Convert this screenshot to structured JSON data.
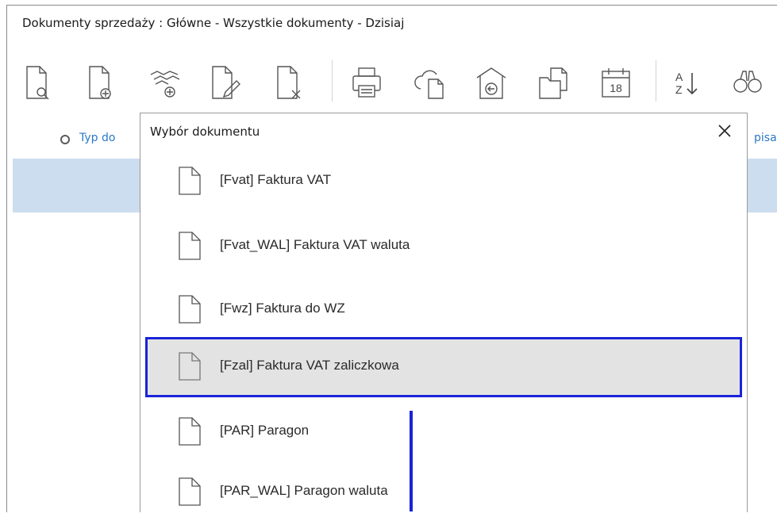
{
  "window": {
    "title": "Dokumenty sprzedaży : Główne - Wszystkie dokumenty - Dzisiaj"
  },
  "toolbar": {
    "icons": [
      "document-preview-icon",
      "document-add-icon",
      "handshake-add-icon",
      "document-edit-icon",
      "document-delete-icon",
      "print-icon",
      "cloud-document-icon",
      "home-export-icon",
      "folder-document-icon",
      "calendar-icon",
      "sort-az-icon",
      "binoculars-icon"
    ],
    "calendar_day": "18",
    "sort_top": "A",
    "sort_bottom": "Z"
  },
  "columns": {
    "typ": "Typ do",
    "opis": "pisa"
  },
  "modal": {
    "title": "Wybór dokumentu",
    "close_icon": "close-icon",
    "items": [
      {
        "label": "[Fvat] Faktura VAT",
        "selected": false
      },
      {
        "label": "[Fvat_WAL] Faktura VAT waluta",
        "selected": false
      },
      {
        "label": "[Fwz] Faktura do WZ",
        "selected": false
      },
      {
        "label": "[Fzal] Faktura VAT zaliczkowa",
        "selected": true
      },
      {
        "label": "[PAR] Paragon",
        "selected": false
      },
      {
        "label": "[PAR_WAL] Paragon waluta",
        "selected": false
      }
    ]
  },
  "colors": {
    "selection_band": "#cdddf0",
    "highlight_border": "#1a23d8",
    "selected_item_bg": "#e3e3e3",
    "link": "#2b78c5"
  }
}
